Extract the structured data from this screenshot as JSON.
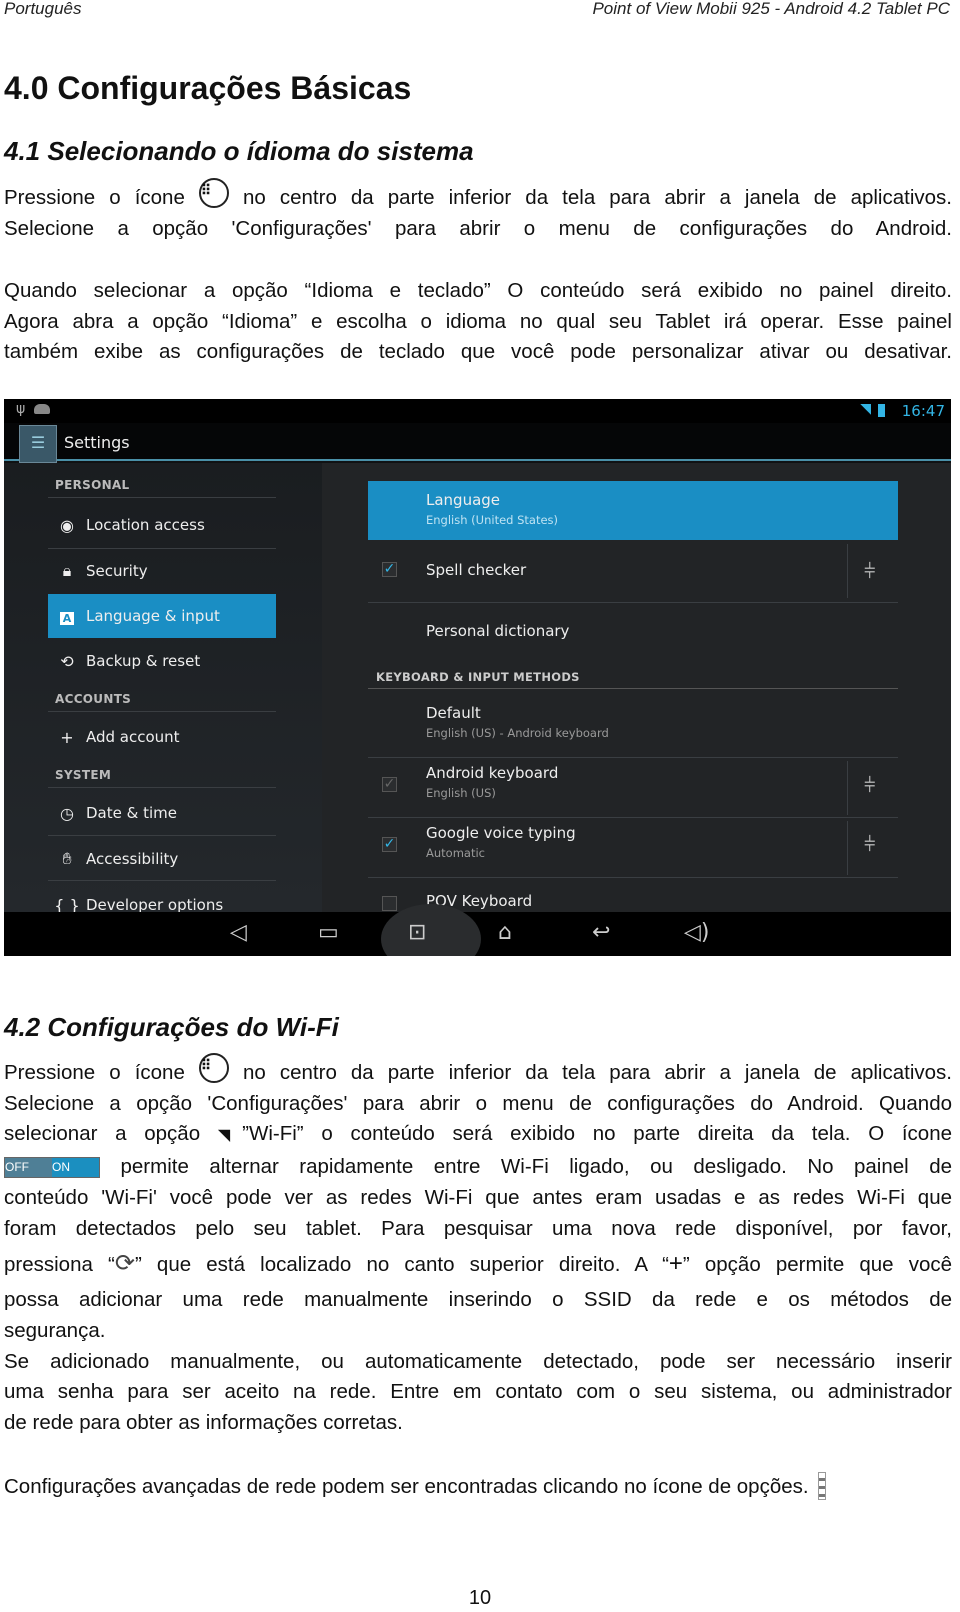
{
  "header": {
    "left": "Português",
    "right": "Point of View Mobii 925 - Android 4.2 Tablet PC"
  },
  "title": "4.0 Configurações Básicas",
  "section1": {
    "heading": "4.1 Selecionando o ídioma do sistema",
    "p1": [
      "Pressione o ícone",
      "no centro da parte inferior da tela para abrir a janela de aplicativos.",
      "Selecione a opção 'Configurações' para abrir o menu de configurações do Android."
    ],
    "p2": [
      "Quando selecionar a opção “Idioma e teclado” O conteúdo será exibido no painel direito.",
      "Agora abra a opção “Idioma” e escolha o idioma no qual seu Tablet irá operar. Esse painel",
      "também exibe as configurações de teclado que você pode personalizar ativar ou desativar."
    ]
  },
  "screenshot": {
    "time": "16:47",
    "app_title": "Settings",
    "accent": "#33b5e5",
    "left": {
      "personal": "PERSONAL",
      "accounts": "ACCOUNTS",
      "system": "SYSTEM",
      "items": [
        "Location access",
        "Security",
        "Language & input",
        "Backup & reset",
        "Add account",
        "Date & time",
        "Accessibility",
        "Developer options"
      ]
    },
    "right": {
      "language": "Language",
      "language_sub": "English (United States)",
      "spell": "Spell checker",
      "dictionary": "Personal dictionary",
      "kb_header": "KEYBOARD & INPUT METHODS",
      "default": "Default",
      "default_sub": "English (US) - Android keyboard",
      "android_kb": "Android keyboard",
      "android_kb_sub": "English (US)",
      "voice": "Google voice typing",
      "voice_sub": "Automatic",
      "pov": "POV Keyboard"
    }
  },
  "section2": {
    "heading": "4.2 Configurações do Wi-Fi",
    "l1a": "Pressione o ícone",
    "l1b": "no centro da parte inferior da tela para abrir a janela de aplicativos.",
    "l2": "Selecione a opção 'Configurações' para abrir o menu de configurações do Android. Quando",
    "l3a": "selecionar a opção",
    "l3b": "”Wi-Fi” o conteúdo será exibido no parte direita da tela. O ícone",
    "toggle_off": "OFF",
    "toggle_on": "ON",
    "l4": "permite alternar rapidamente entre Wi-Fi ligado, ou desligado. No painel de",
    "l5": "conteúdo 'Wi-Fi' você pode ver as redes Wi-Fi que antes eram usadas e as redes Wi-Fi que",
    "l6": "foram detectados pelo seu tablet. Para pesquisar uma nova rede disponível, por favor,",
    "l7a": "pressiona “",
    "l7b": "” que está localizado no canto superior direito. A “",
    "l7c": "” opção permite que você",
    "l8": "possa adicionar uma rede manualmente inserindo o SSID da rede e os métodos de",
    "l9": "segurança.",
    "l10": "Se adicionado manualmente, ou automaticamente detectado, pode ser necessário inserir",
    "l11": "uma senha para ser aceito na rede. Entre em contato com o seu sistema, ou administrador",
    "l12": "de rede para obter as informações corretas.",
    "l13": "Configurações avançadas de rede podem ser encontradas clicando no ícone de opções."
  },
  "page_number": "10"
}
